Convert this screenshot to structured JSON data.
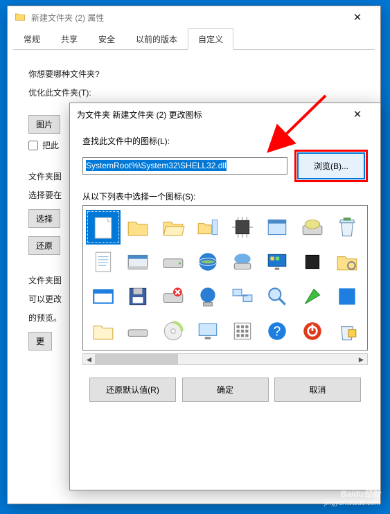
{
  "properties_dialog": {
    "title": "新建文件夹 (2) 属性",
    "close_glyph": "✕",
    "tabs": [
      "常规",
      "共享",
      "安全",
      "以前的版本",
      "自定义"
    ],
    "active_tab_index": 4,
    "body": {
      "question": "你想要哪种文件夹?",
      "optimize_label": "优化此文件夹(T):",
      "image_button": "图片",
      "checkbox_label": "把此",
      "section2_label": "文件夹图",
      "choose_label": "选择要在",
      "choose_btn": "选择",
      "restore_btn": "还原",
      "section3_label": "文件夹图",
      "change_desc": "可以更改",
      "preview_label": "的预览。",
      "change_btn": "更"
    }
  },
  "change_icon_dialog": {
    "title": "为文件夹 新建文件夹 (2) 更改图标",
    "close_glyph": "✕",
    "lookup_label": "查找此文件中的图标(L):",
    "path_value": "SystemRoot%\\System32\\SHELL32.dll",
    "browse_label": "浏览(B)...",
    "select_label": "从以下列表中选择一个图标(S):",
    "icons": [
      "blank-page",
      "folder",
      "folder-open",
      "tree-open",
      "chip",
      "app-window",
      "drive-cd",
      "recycle-full",
      "document-text",
      "exe-window",
      "drive",
      "internet-globe",
      "cloud-drive",
      "display-apps",
      "black-box",
      "folder-gear",
      "window-blue",
      "floppy",
      "drive-x",
      "network-globe",
      "network-computers",
      "magnifier",
      "help-arrow",
      "blue-blank",
      "folder-empty",
      "drive-flat",
      "cd-disc",
      "monitor",
      "keypad",
      "help-question",
      "power-off",
      "recycle-chip"
    ],
    "selected_icon_index": 0,
    "buttons": {
      "restore_default": "还原默认值(R)",
      "ok": "确定",
      "cancel": "取消"
    }
  },
  "watermark": {
    "line1": "Baidu经验",
    "line2": "jingyan.baidu.com"
  }
}
